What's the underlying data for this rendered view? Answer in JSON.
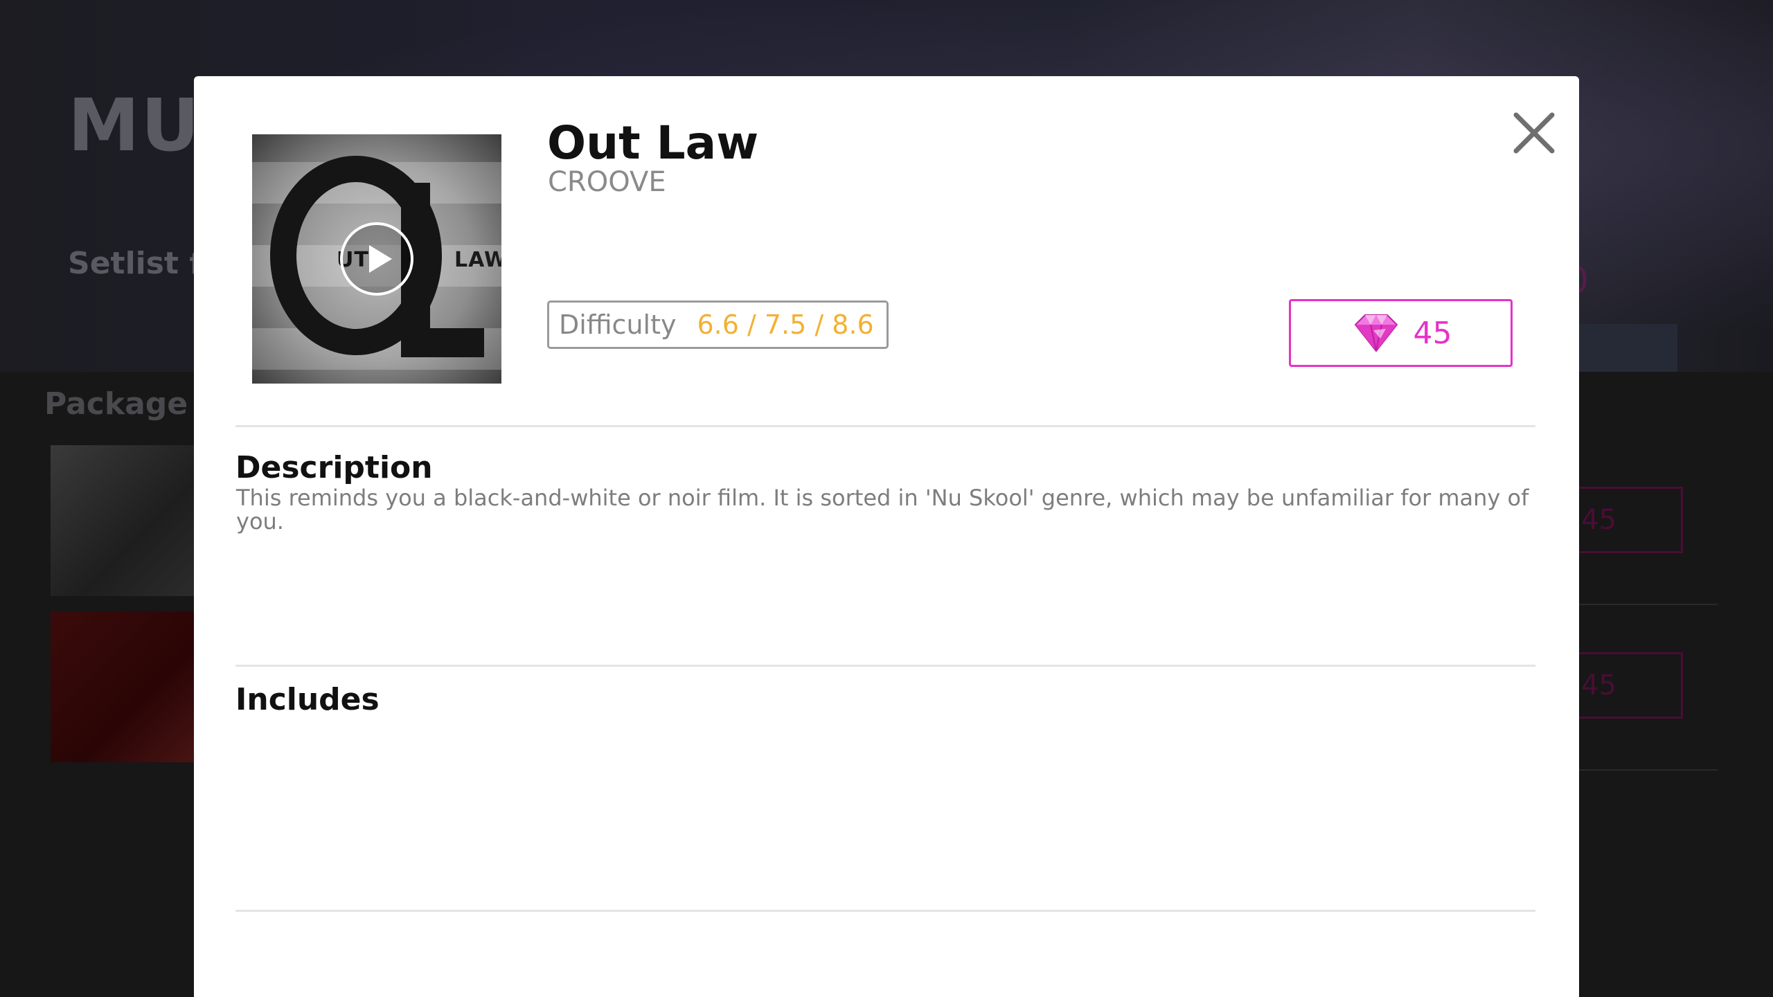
{
  "background": {
    "title": "MUC",
    "subtitle": "Setlist fr",
    "top_price": "0",
    "section_title": "Package li",
    "items": [
      {
        "price": "45"
      },
      {
        "price": "45"
      }
    ]
  },
  "modal": {
    "song": {
      "title": "Out Law",
      "artist": "CROOVE",
      "cover_text_left": "UT",
      "cover_text_right": "LAW"
    },
    "difficulty": {
      "label": "Difficulty",
      "value": "6.6 / 7.5 / 8.6"
    },
    "price": {
      "value": "45",
      "currency_icon": "gem-icon"
    },
    "description": {
      "heading": "Description",
      "text": "This reminds you a black-and-white or noir film. It is sorted in 'Nu Skool' genre, which may be unfamiliar for many of you."
    },
    "includes": {
      "heading": "Includes"
    }
  },
  "colors": {
    "accent_pink": "#e632c8",
    "difficulty_orange": "#f2b134",
    "text_gray": "#7d7d7d"
  }
}
